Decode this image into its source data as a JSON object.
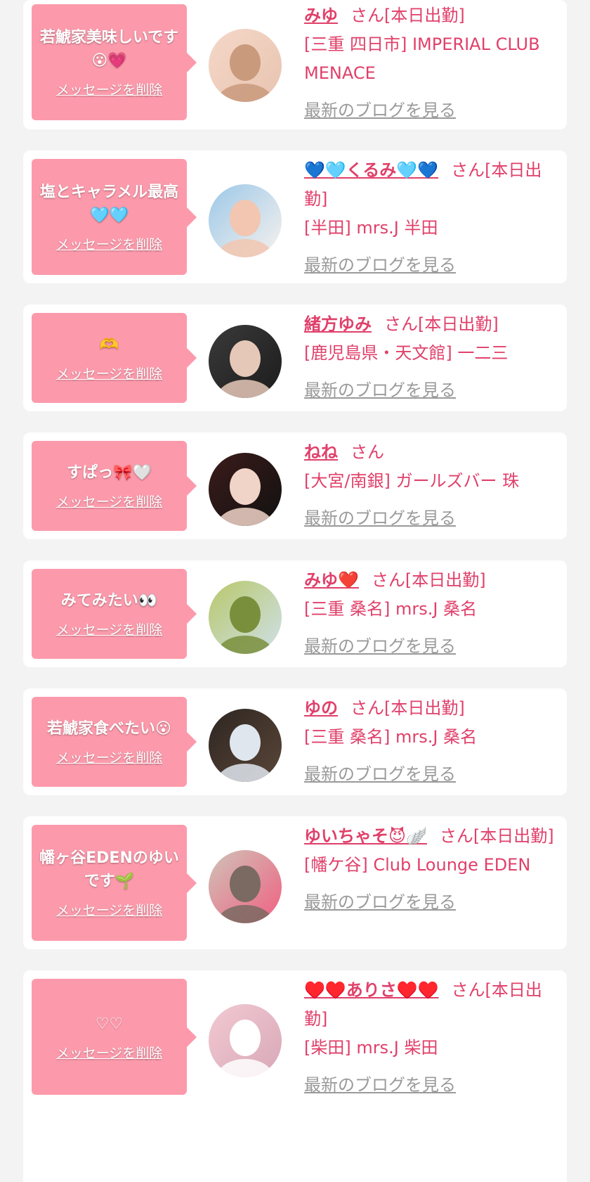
{
  "common": {
    "delete_label": "メッセージを削除",
    "blog_label": "最新のブログを見る",
    "san_suffix": "さん"
  },
  "colors": {
    "page_background": "#f3f3f3",
    "card_background": "#ffffff",
    "bubble_pink": "#fc9aac",
    "accent_pink": "#e0406a",
    "link_gray": "#9a9a9a"
  },
  "cards": [
    {
      "message": "若鯱家美味しいです😮💗",
      "name": "みゆ",
      "status": "[本日出勤]",
      "place": "[三重 四日市] IMPERIAL CLUB MENACE",
      "avatar_icon": "profile-photo-icon",
      "avatar_colors": [
        "#f5d7c8",
        "#c99a7c",
        "#e8c4b0"
      ]
    },
    {
      "message": "塩とキャラメル最高🩵🩵",
      "name": "💙🩵くるみ🩵💙",
      "status": "[本日出勤]",
      "place": "[半田] mrs.J 半田",
      "avatar_icon": "profile-photo-icon",
      "avatar_colors": [
        "#9cc8e8",
        "#f2c6b0",
        "#f7f2ee"
      ]
    },
    {
      "message": "🫶",
      "name": "緒方ゆみ",
      "status": "[本日出勤]",
      "place": "[鹿児島県・天文館] 一二三",
      "avatar_icon": "profile-photo-icon",
      "avatar_colors": [
        "#3a3a3a",
        "#e6c8b8",
        "#1c1c1c"
      ]
    },
    {
      "message": "すぱっ🎀🤍",
      "name": "ねね",
      "status": "",
      "place": "[大宮/南銀] ガールズバー 珠",
      "avatar_icon": "profile-photo-icon",
      "avatar_colors": [
        "#3b1c1a",
        "#f1d4c8",
        "#111111"
      ]
    },
    {
      "message": "みてみたい👀",
      "name": "みゆ❤️",
      "status": "[本日出勤]",
      "place": "[三重 桑名] mrs.J 桑名",
      "avatar_icon": "profile-photo-icon",
      "avatar_colors": [
        "#b8c86a",
        "#7a8f3c",
        "#cfe0ea"
      ]
    },
    {
      "message": "若鯱家食べたい😮",
      "name": "ゆの",
      "status": "[本日出勤]",
      "place": "[三重 桑名] mrs.J 桑名",
      "avatar_icon": "profile-photo-icon",
      "avatar_colors": [
        "#2e2622",
        "#dfe6ee",
        "#5a4638"
      ]
    },
    {
      "message": "幡ヶ谷EDENのゆいです🌱",
      "name": "ゆいちゃそ😈🪽",
      "status": "[本日出勤]",
      "place": "[幡ケ谷] Club Lounge EDEN",
      "avatar_icon": "profile-photo-icon",
      "avatar_colors": [
        "#cfc3b8",
        "#7a6a62",
        "#f06080"
      ]
    },
    {
      "message": "♡♡",
      "name": "♥️♥️ありさ♥️♥️",
      "status": "[本日出勤]",
      "place": "[柴田] mrs.J 柴田",
      "avatar_icon": "profile-photo-icon",
      "avatar_colors": [
        "#f2c9d2",
        "#ffffff",
        "#d8a8b8"
      ]
    }
  ]
}
